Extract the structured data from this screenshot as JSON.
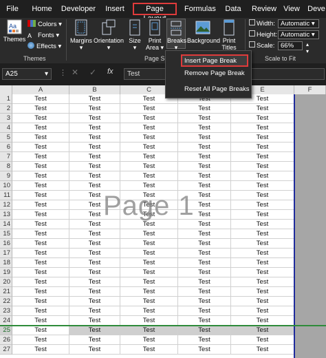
{
  "tabs": [
    "File",
    "Home",
    "Developer",
    "Insert",
    "Page Layout",
    "Formulas",
    "Data",
    "Review",
    "View",
    "Deve"
  ],
  "ribbon": {
    "themes": {
      "big": "Themes",
      "colors": "Colors",
      "fonts": "Fonts",
      "effects": "Effects",
      "group": "Themes"
    },
    "page_setup": {
      "margins": "Margins",
      "orientation": "Orientation",
      "size": "Size",
      "print_area_1": "Print",
      "print_area_2": "Area",
      "breaks": "Breaks",
      "background": "Background",
      "print_titles_1": "Print",
      "print_titles_2": "Titles",
      "group": "Page Setup"
    },
    "scale": {
      "width_label": "Width:",
      "width_val": "Automatic",
      "height_label": "Height:",
      "height_val": "Automatic",
      "scale_label": "Scale:",
      "scale_val": "66%",
      "group": "Scale to Fit"
    }
  },
  "formula_bar": {
    "name_box": "A25",
    "content": "Test",
    "fx": "fx"
  },
  "breaks_menu": [
    "Insert Page Break",
    "Remove Page Break",
    "Reset All Page Breaks"
  ],
  "columns": [
    "A",
    "B",
    "C",
    "D",
    "E",
    "F"
  ],
  "rows": [
    1,
    2,
    3,
    4,
    5,
    6,
    7,
    8,
    9,
    10,
    11,
    12,
    13,
    14,
    15,
    16,
    17,
    18,
    19,
    20,
    21,
    22,
    23,
    24,
    25,
    26,
    27
  ],
  "cell_value": "Test",
  "watermark": "Page 1",
  "colors": {
    "accent_red": "#e03b3b",
    "page_border": "#1e2a9c",
    "selection": "#2e8b3a"
  }
}
